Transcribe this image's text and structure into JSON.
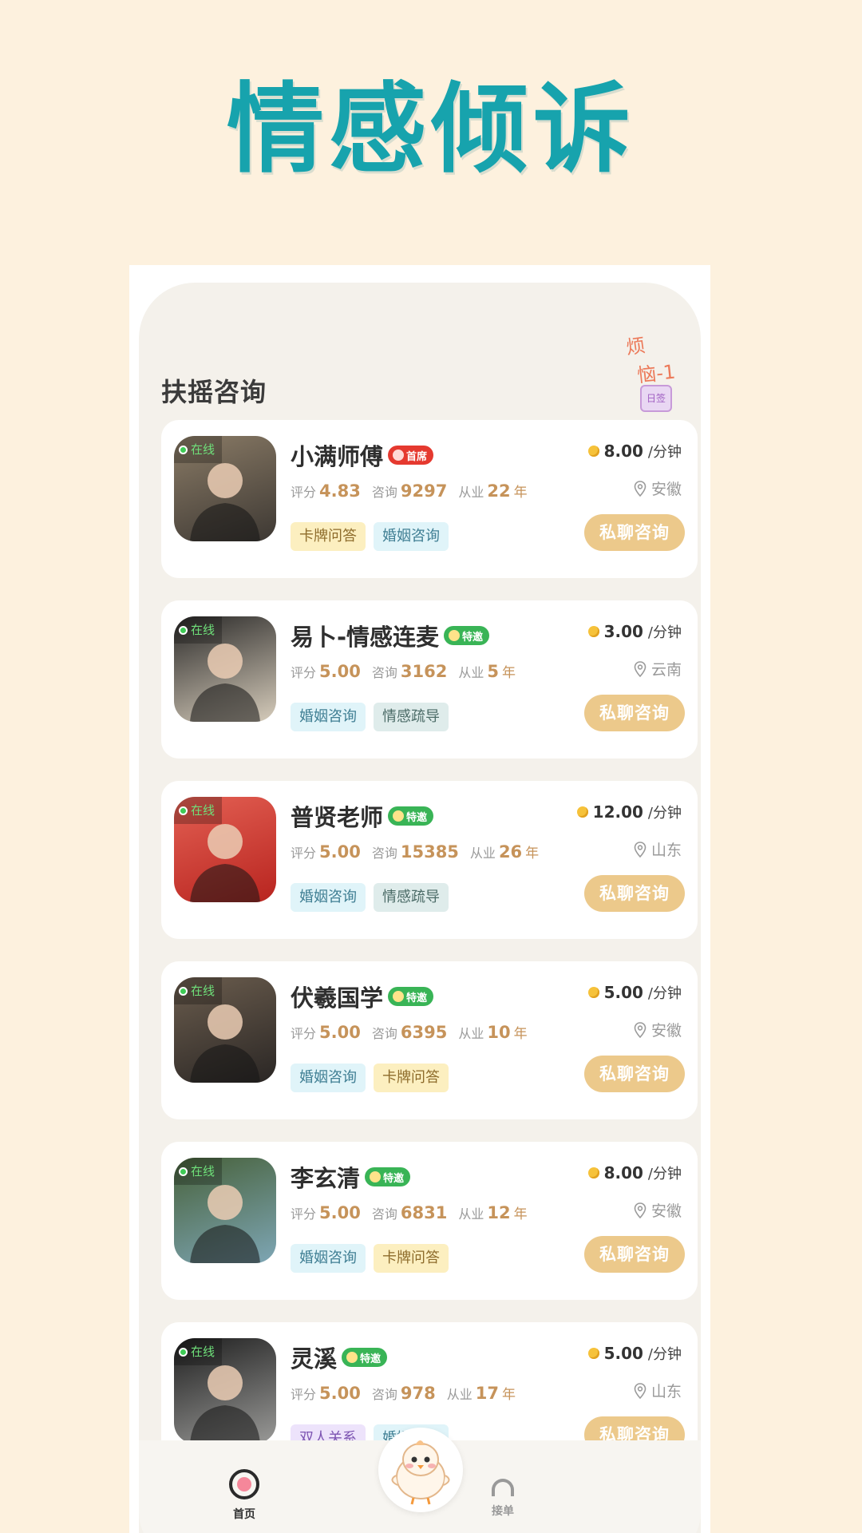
{
  "hero": {
    "title": "情感倾诉"
  },
  "section": {
    "title": "扶摇咨询"
  },
  "sticker": {
    "line1": "烦",
    "line2": "恼-1",
    "calendar": "日签"
  },
  "labels": {
    "online": "在线",
    "rating": "评分",
    "consults": "咨询",
    "experience": "从业",
    "years_unit": "年",
    "per_minute": "/分钟",
    "chat_button": "私聊咨询"
  },
  "advisors": [
    {
      "name": "小满师傅",
      "badge": "首席",
      "badge_color": "#e5392f",
      "price": "8.00",
      "location": "安徽",
      "rating": "4.83",
      "consults": "9297",
      "years": "22",
      "tags": [
        "卡牌问答",
        "婚姻咨询"
      ],
      "avatar_colors": [
        "#3d3833",
        "#8a7b66"
      ]
    },
    {
      "name": "易卜-情感连麦",
      "badge": "特邀",
      "badge_color": "#39b456",
      "price": "3.00",
      "location": "云南",
      "rating": "5.00",
      "consults": "3162",
      "years": "5",
      "tags": [
        "婚姻咨询",
        "情感疏导"
      ],
      "avatar_colors": [
        "#d6ccbb",
        "#2b2a29"
      ]
    },
    {
      "name": "普贤老师",
      "badge": "特邀",
      "badge_color": "#39b456",
      "price": "12.00",
      "location": "山东",
      "rating": "5.00",
      "consults": "15385",
      "years": "26",
      "tags": [
        "婚姻咨询",
        "情感疏导"
      ],
      "avatar_colors": [
        "#b8241f",
        "#e36053"
      ]
    },
    {
      "name": "伏羲国学",
      "badge": "特邀",
      "badge_color": "#39b456",
      "price": "5.00",
      "location": "安徽",
      "rating": "5.00",
      "consults": "6395",
      "years": "10",
      "tags": [
        "婚姻咨询",
        "卡牌问答"
      ],
      "avatar_colors": [
        "#2a2624",
        "#6b5d4e"
      ]
    },
    {
      "name": "李玄清",
      "badge": "特邀",
      "badge_color": "#39b456",
      "price": "8.00",
      "location": "安徽",
      "rating": "5.00",
      "consults": "6831",
      "years": "12",
      "tags": [
        "婚姻咨询",
        "卡牌问答"
      ],
      "avatar_colors": [
        "#7ea6b5",
        "#47613a"
      ]
    },
    {
      "name": "灵溪",
      "badge": "特邀",
      "badge_color": "#39b456",
      "price": "5.00",
      "location": "山东",
      "rating": "5.00",
      "consults": "978",
      "years": "17",
      "tags": [
        "双人关系",
        "婚姻咨询"
      ],
      "avatar_colors": [
        "#9a9a98",
        "#1f1f1f"
      ]
    }
  ],
  "tag_styles": {
    "婚姻咨询": "blue",
    "卡牌问答": "yellow",
    "情感疏导": "sage",
    "双人关系": "purple"
  },
  "nav": {
    "home": {
      "label": "首页",
      "icon": "home-icon"
    },
    "orders": {
      "label": "接单",
      "icon": "orders-icon"
    },
    "center": {
      "icon": "mascot-chick-icon"
    }
  },
  "colors": {
    "accent": "#17a3ad",
    "button": "#ecc98b",
    "background": "#fdf1de"
  }
}
